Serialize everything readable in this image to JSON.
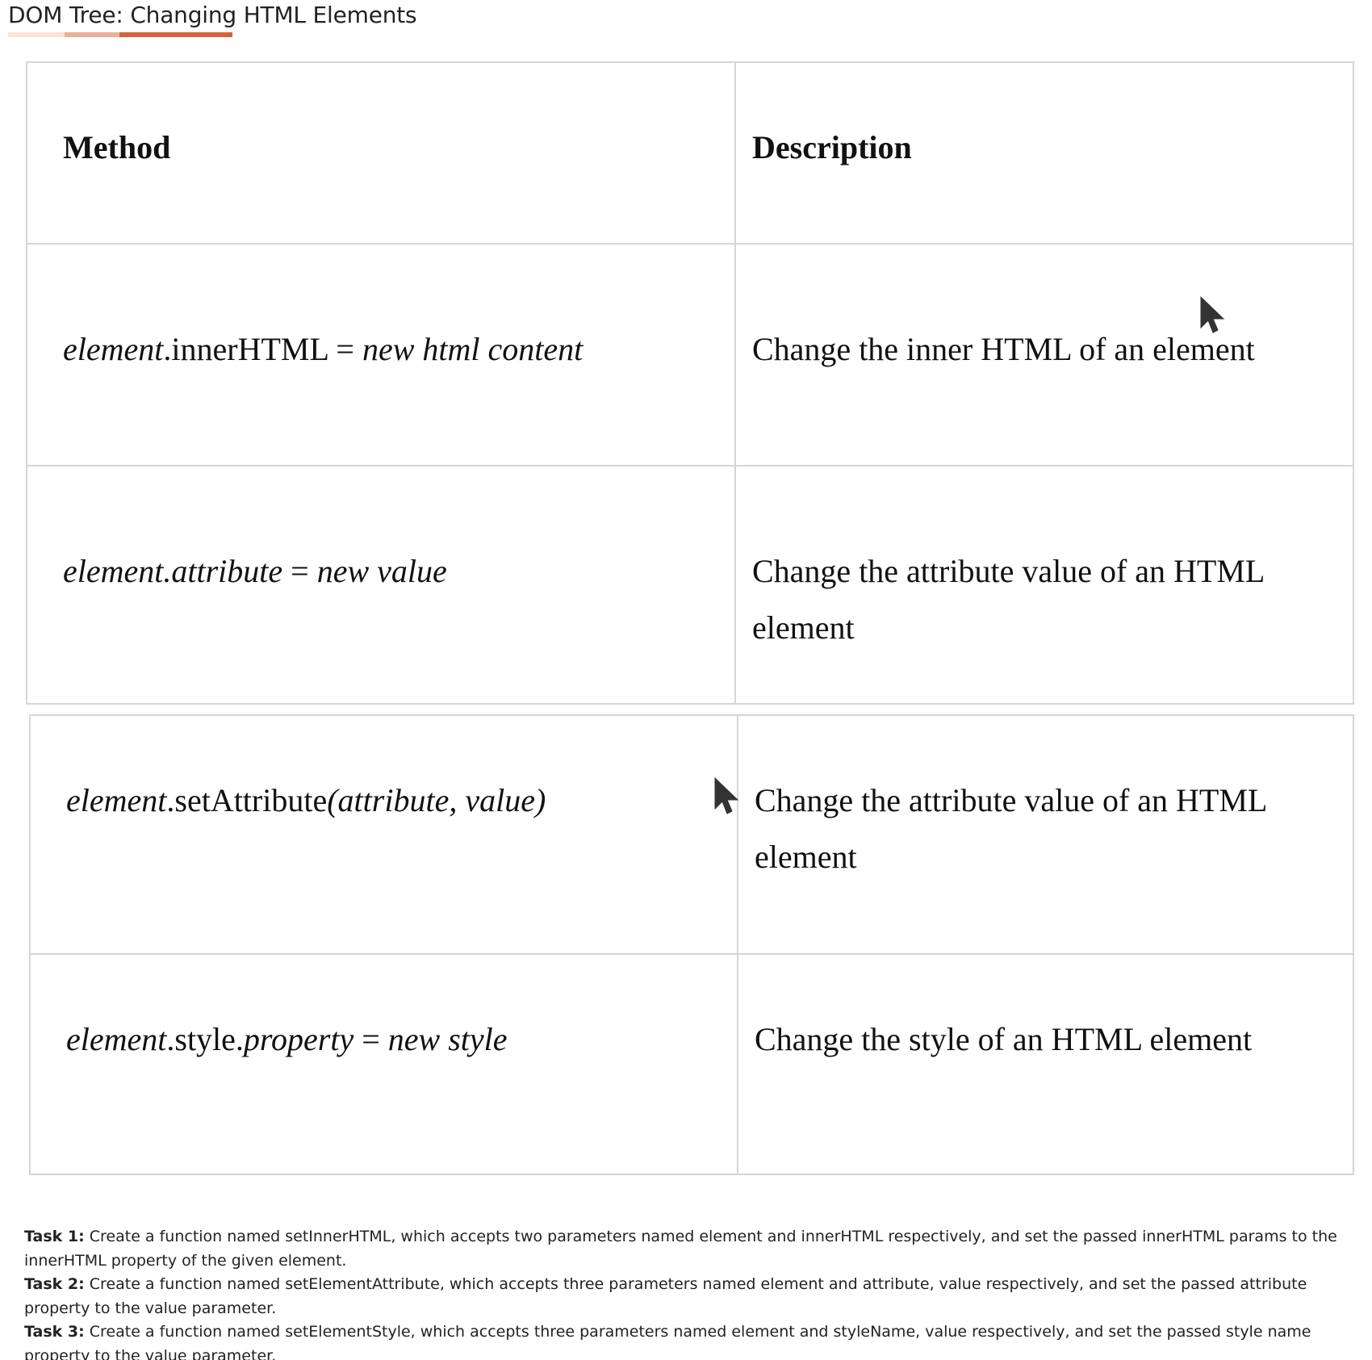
{
  "header": {
    "title": "DOM Tree: Changing HTML Elements"
  },
  "table": {
    "columns": [
      "Method",
      "Description"
    ],
    "rows": [
      {
        "method": {
          "part1": "element",
          "part2": ".innerHTML = ",
          "part3": "new html content"
        },
        "description": "Change the inner HTML of an element"
      },
      {
        "method": {
          "part1": "element.attribute",
          "part2": " = ",
          "part3": "new value"
        },
        "description": "Change the attribute value of an HTML element"
      },
      {
        "method": {
          "part1": "element",
          "part2": ".setAttribute",
          "part3": "(attribute, value)"
        },
        "description": "Change the attribute value of an HTML element"
      },
      {
        "method": {
          "part1": "element",
          "part2": ".style.",
          "part3": "property",
          "part4": " = ",
          "part5": "new style"
        },
        "description": "Change the style of an HTML element"
      }
    ]
  },
  "tasks": [
    {
      "label": "Task 1:",
      "text": " Create a function named setInnerHTML, which accepts two parameters named element and innerHTML respectively, and set the passed innerHTML params to the innerHTML property of the given element."
    },
    {
      "label": "Task 2:",
      "text": " Create a function named setElementAttribute, which accepts three parameters named element and attribute, value respectively, and set the passed attribute property to the value parameter."
    },
    {
      "label": "Task 3:",
      "text": " Create a function named setElementStyle, which accepts three parameters named element and styleName, value respectively, and set the passed style name property to the value parameter."
    }
  ],
  "icons": {
    "cursor": "mouse-pointer-icon"
  }
}
